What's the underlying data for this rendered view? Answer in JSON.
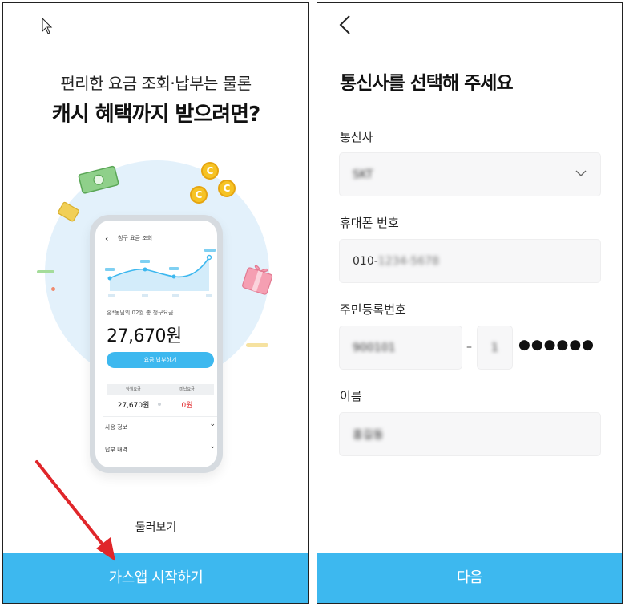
{
  "left_screen": {
    "headline_line1": "편리한 요금 조회·납부는 물론",
    "headline_line2": "캐시 혜택까지 받으려면?",
    "coin_symbol": "C",
    "phone": {
      "title": "청구 요금 조회",
      "summary_label": "홍*동님의 02월 총 청구요금",
      "amount": "27,670원",
      "pay_button": "요금 납부하기",
      "table_headers": [
        "당월요금",
        "미납요금"
      ],
      "table_values": [
        "27,670원",
        "0원"
      ],
      "list_items": [
        "사용 정보",
        "납부 내역"
      ]
    },
    "browse_link": "둘러보기",
    "start_button": "가스앱 시작하기"
  },
  "right_screen": {
    "title": "통신사를 선택해 주세요",
    "carrier_label": "통신사",
    "carrier_value": "SKT",
    "phone_label": "휴대폰 번호",
    "phone_value_prefix": "010-",
    "phone_value_blurred": "1234-5678",
    "rrn_label": "주민등록번호",
    "rrn_front": "900101",
    "rrn_dash": "–",
    "rrn_gender_digit": "1",
    "rrn_masked": "●●●●●●",
    "name_label": "이름",
    "name_value": "홍길동",
    "next_button": "다음"
  },
  "colors": {
    "accent": "#3db8ef",
    "annotation_arrow": "#e0262a",
    "field_bg": "#f7f7f8",
    "circle_bg": "#e3f1fb"
  }
}
